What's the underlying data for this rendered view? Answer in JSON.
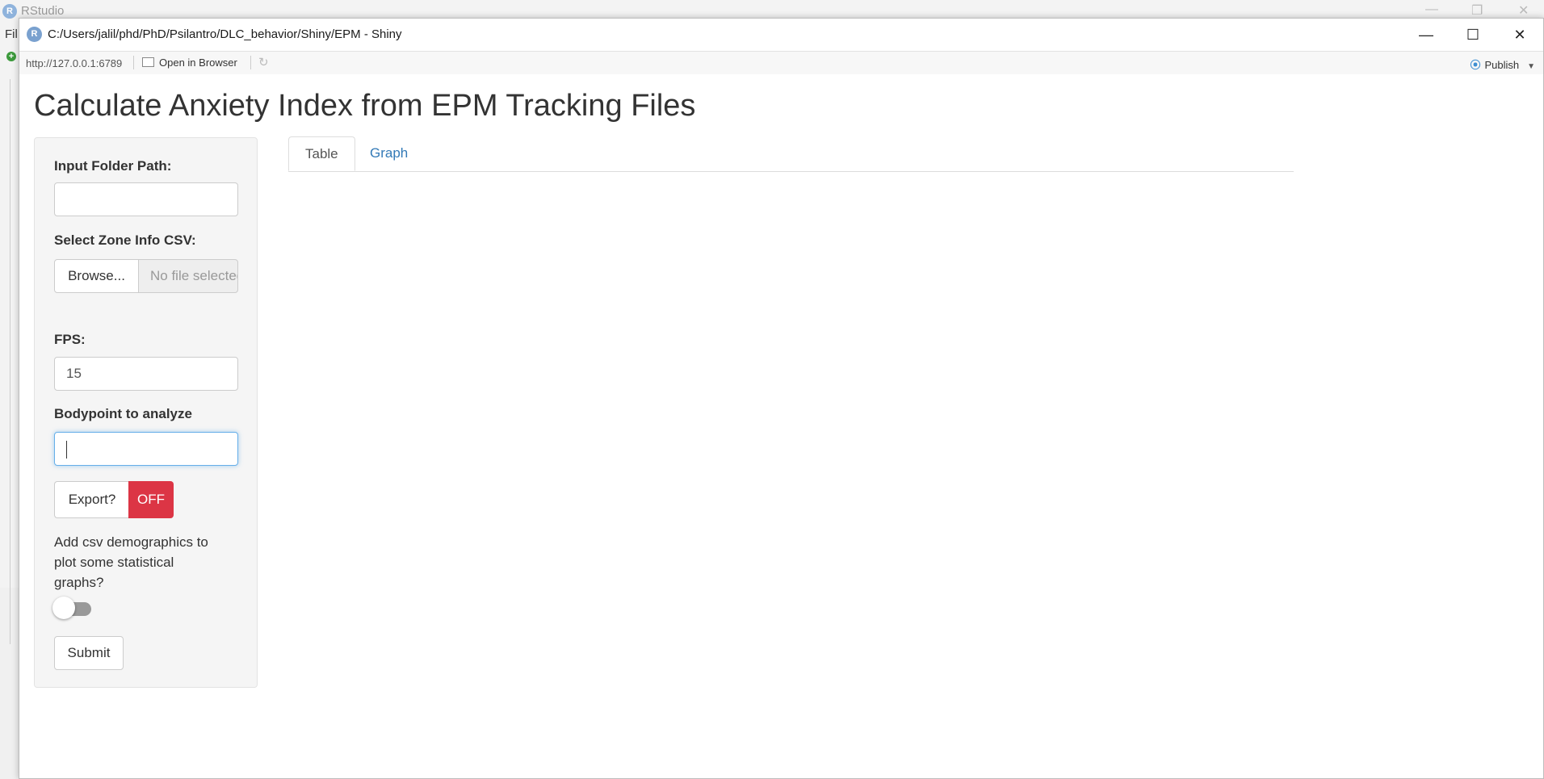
{
  "background_app": {
    "title": "RStudio",
    "logo_letter": "R",
    "menu_fragment": "Fil",
    "restore_glyph": "❐"
  },
  "window": {
    "logo_letter": "R",
    "title": "C:/Users/jalil/phd/PhD/Psilantro/DLC_behavior/Shiny/EPM - Shiny",
    "controls": {
      "minimize": "—",
      "maximize": "☐",
      "close": "✕"
    }
  },
  "toolbar": {
    "url": "http://127.0.0.1:6789",
    "open_in_browser": "Open in Browser",
    "refresh_glyph": "↻",
    "publish_label": "Publish",
    "publish_icon": "⦿",
    "publish_caret": "▼"
  },
  "app": {
    "title": "Calculate Anxiety Index from EPM Tracking Files",
    "sidebar": {
      "input_folder_label": "Input Folder Path:",
      "input_folder_value": "",
      "zone_csv_label": "Select Zone Info CSV:",
      "browse_label": "Browse...",
      "file_placeholder": "No file selected",
      "fps_label": "FPS:",
      "fps_value": "15",
      "bodypoint_label": "Bodypoint to analyze",
      "bodypoint_value": "",
      "export_label": "Export?",
      "export_state": "OFF",
      "demographics_text": "Add csv demographics to plot some statistical graphs?",
      "demographics_toggle_on": false,
      "submit_label": "Submit"
    },
    "tabs": [
      {
        "label": "Table",
        "active": true
      },
      {
        "label": "Graph",
        "active": false
      }
    ]
  },
  "colors": {
    "export_off": "#dc3545",
    "tab_link": "#337ab7",
    "focus_border": "#66afe9",
    "publish_icon": "#3e8fd1"
  }
}
